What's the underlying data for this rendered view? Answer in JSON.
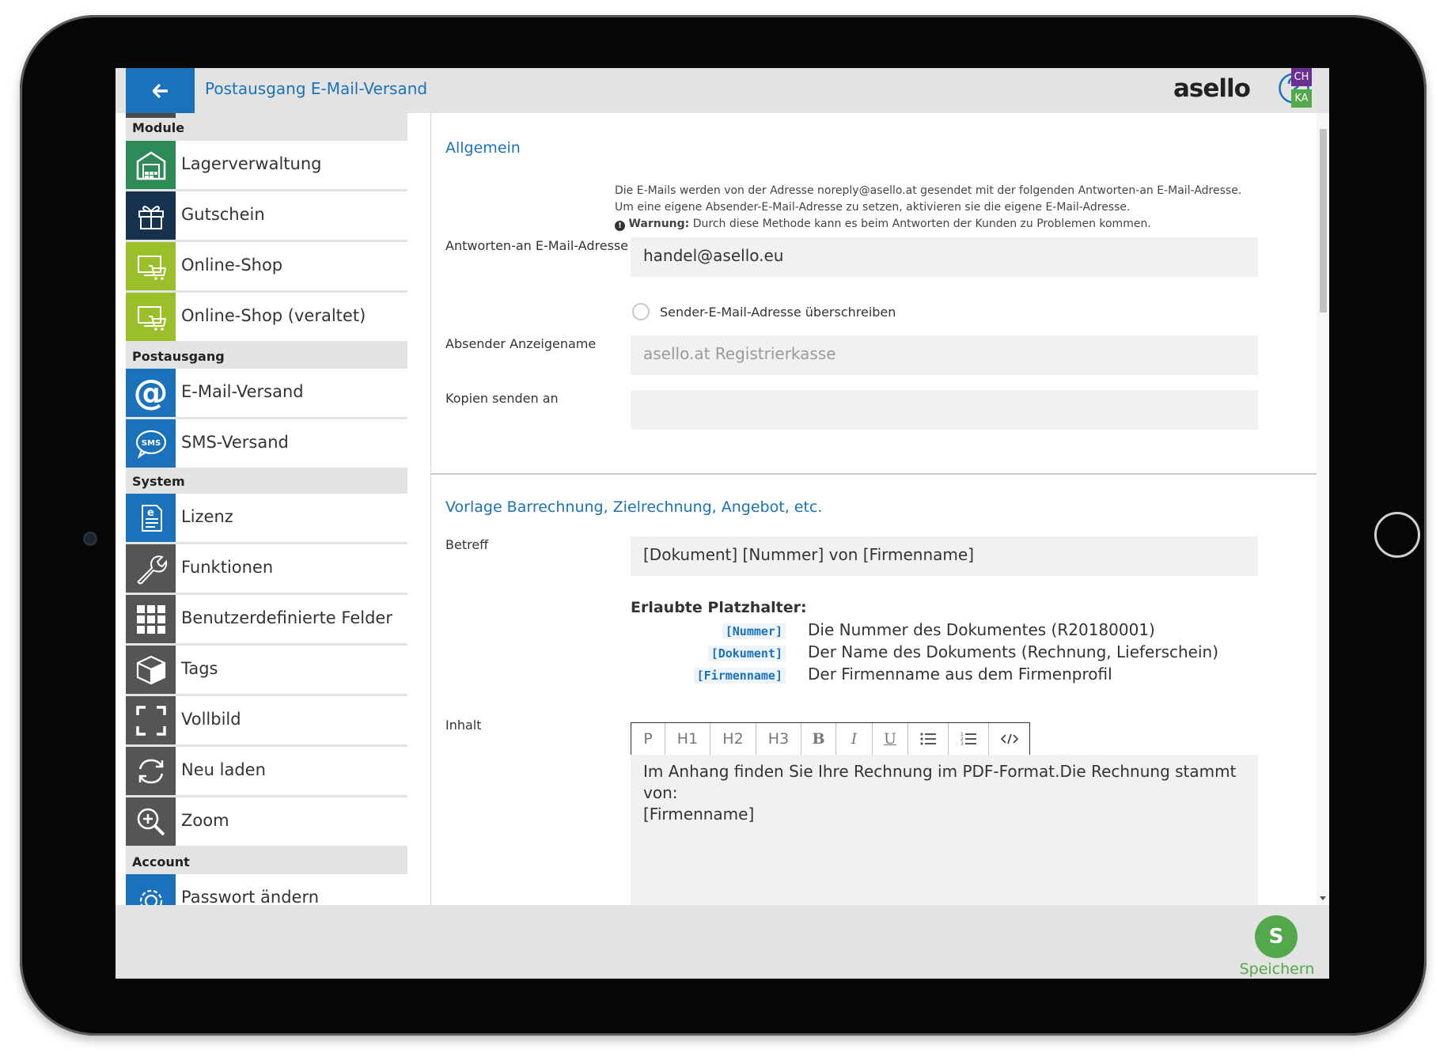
{
  "header": {
    "title": "Postausgang E-Mail-Versand",
    "logo": "asello",
    "badge_top": "CH",
    "badge_bottom": "KA"
  },
  "sidebar": {
    "sections": [
      {
        "title": "Module",
        "items": [
          {
            "label": "Lagerverwaltung",
            "icon": "warehouse-icon",
            "color": "#2e8b57"
          },
          {
            "label": "Gutschein",
            "icon": "gift-icon",
            "color": "#16324f"
          },
          {
            "label": "Online-Shop",
            "icon": "online-shop-icon",
            "color": "#9bbf2a"
          },
          {
            "label": "Online-Shop (veraltet)",
            "icon": "online-shop-legacy-icon",
            "color": "#9bbf2a"
          }
        ]
      },
      {
        "title": "Postausgang",
        "items": [
          {
            "label": "E-Mail-Versand",
            "icon": "at-sign-icon",
            "color": "#1a72bb"
          },
          {
            "label": "SMS-Versand",
            "icon": "sms-icon",
            "color": "#1a72bb"
          }
        ]
      },
      {
        "title": "System",
        "items": [
          {
            "label": "Lizenz",
            "icon": "license-icon",
            "color": "#1a72bb"
          },
          {
            "label": "Funktionen",
            "icon": "wrench-icon",
            "color": "#555555"
          },
          {
            "label": "Benutzerdefinierte Felder",
            "icon": "grid-icon",
            "color": "#555555"
          },
          {
            "label": "Tags",
            "icon": "cube-icon",
            "color": "#555555"
          },
          {
            "label": "Vollbild",
            "icon": "fullscreen-icon",
            "color": "#555555"
          },
          {
            "label": "Neu laden",
            "icon": "reload-icon",
            "color": "#555555"
          },
          {
            "label": "Zoom",
            "icon": "zoom-icon",
            "color": "#555555"
          }
        ]
      },
      {
        "title": "Account",
        "items": [
          {
            "label": "Passwort ändern",
            "icon": "settings-icon",
            "color": "#1a72bb"
          }
        ]
      }
    ]
  },
  "general": {
    "section_title": "Allgemein",
    "info_line1": "Die E-Mails werden von der Adresse noreply@asello.at gesendet mit der folgenden Antworten-an E-Mail-Adresse.",
    "info_line2": "Um eine eigene Absender-E-Mail-Adresse zu setzen, aktivieren sie die eigene E-Mail-Adresse.",
    "warning_label": "Warnung:",
    "warning_text": "Durch diese Methode kann es beim Antworten der Kunden zu Problemen kommen.",
    "reply_to_label": "Antworten-an E-Mail-Adresse",
    "reply_to_value": "handel@asello.eu",
    "override_sender_label": "Sender-E-Mail-Adresse überschreiben",
    "sender_name_label": "Absender Anzeigename",
    "sender_name_placeholder": "asello.at Registrierkasse",
    "cc_label": "Kopien senden an",
    "cc_value": ""
  },
  "template": {
    "section_title": "Vorlage Barrechnung, Zielrechnung, Angebot, etc.",
    "subject_label": "Betreff",
    "subject_value": "[Dokument] [Nummer] von [Firmenname]",
    "placeholders_title": "Erlaubte Platzhalter:",
    "placeholders": [
      {
        "code": "[Nummer]",
        "desc": "Die Nummer des Dokumentes (R20180001)"
      },
      {
        "code": "[Dokument]",
        "desc": "Der Name des Dokuments (Rechnung, Lieferschein)"
      },
      {
        "code": "[Firmenname]",
        "desc": "Der Firmenname aus dem Firmenprofil"
      }
    ],
    "content_label": "Inhalt",
    "toolbar": [
      "P",
      "H1",
      "H2",
      "H3",
      "B",
      "I",
      "U",
      "bullet-list-icon",
      "numbered-list-icon",
      "code-icon"
    ],
    "content_line1": "Im Anhang finden Sie Ihre Rechnung im PDF-Format.Die Rechnung stammt von:",
    "content_line2": "[Firmenname]"
  },
  "footer": {
    "save_letter": "S",
    "save_label": "Speichern"
  },
  "colors": {
    "accent": "#1a72bb",
    "save_green": "#52a84a",
    "badge_purple": "#6b2f8f"
  }
}
